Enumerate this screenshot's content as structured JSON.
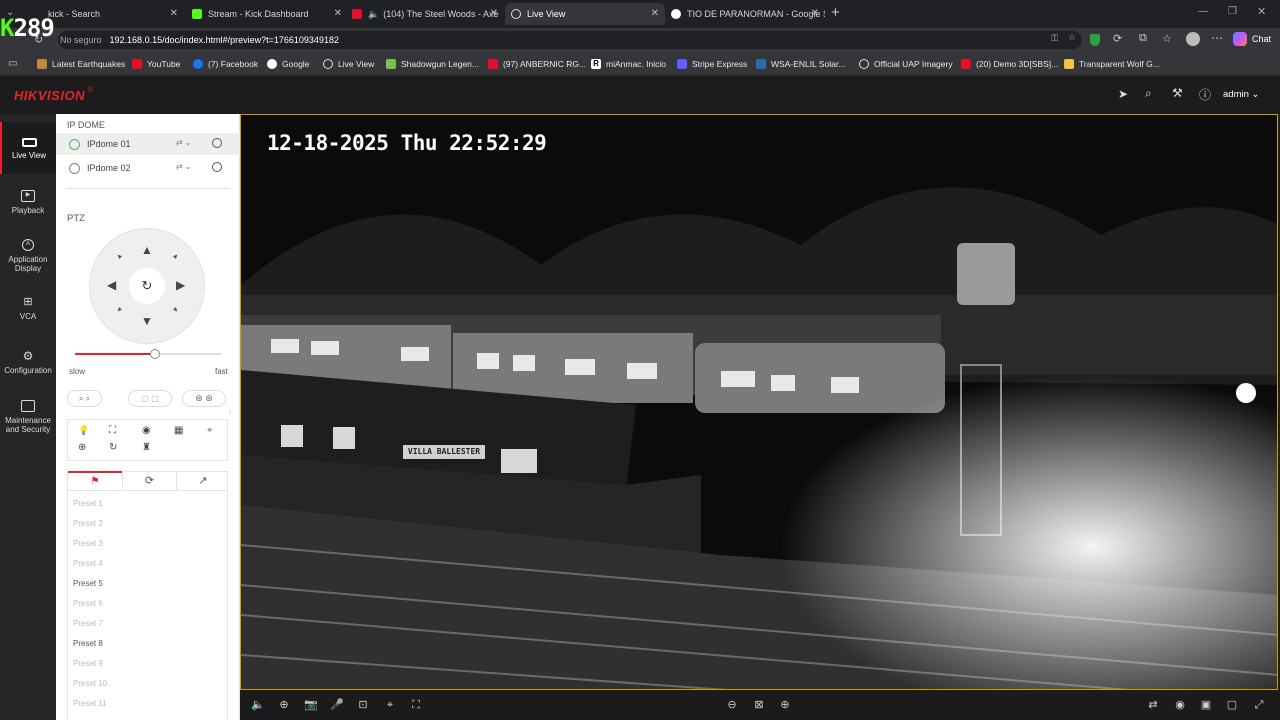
{
  "browser": {
    "tabs": [
      {
        "title": "kick - Search"
      },
      {
        "title": "Stream - Kick Dashboard"
      },
      {
        "title": "(104) The Steel Woods - Axe"
      },
      {
        "title": "Live View"
      },
      {
        "title": "TIO DE PARANORMAN - Google S"
      }
    ],
    "new_tab_glyph": "+",
    "overlay_counter": "289",
    "address": {
      "security_label": "No seguro",
      "url": "192.168.0.15/doc/index.html#/preview?t=1766109349182"
    },
    "chat_label": "Chat",
    "bookmarks": [
      "Latest Earthquakes",
      "YouTube",
      "(7) Facebook",
      "Google",
      "Live View",
      "Shadowgun Legen...",
      "(97) ANBERNIC RG...",
      "miAnmac. Inicio",
      "Stripe Express",
      "WSA-ENLIL Solar...",
      "Official UAP Imagery",
      "(20) Demo 3D[SBS]...",
      "Transparent Wolf G..."
    ]
  },
  "app": {
    "logo": "HIKVISION",
    "user": "admin",
    "nav": [
      {
        "label": "Live View",
        "icon": "monitor-icon"
      },
      {
        "label": "Playback",
        "icon": "playback-icon"
      },
      {
        "label": "Application Display",
        "icon": "application-icon"
      },
      {
        "label": "VCA",
        "icon": "vca-icon"
      },
      {
        "label": "Configuration",
        "icon": "gear-icon"
      },
      {
        "label": "Maintenance and Security",
        "icon": "maintenance-icon"
      }
    ],
    "panel": {
      "group": "IP DOME",
      "cameras": [
        "IPdome 01",
        "IPdome 02"
      ],
      "ptz_title": "PTZ",
      "speed": {
        "slow": "slow",
        "fast": "fast",
        "value": 0.55
      },
      "presets": [
        "Preset 1",
        "Preset 2",
        "Preset 3",
        "Preset 4",
        "Preset 5",
        "Preset 6",
        "Preset 7",
        "Preset 8",
        "Preset 9",
        "Preset 10",
        "Preset 11"
      ]
    },
    "video": {
      "osd": "12-18-2025 Thu 22:52:29",
      "station_sign": "VILLA BALLESTER"
    }
  },
  "colors": {
    "brand": "#e4242a",
    "accent_border": "#c8a200"
  }
}
